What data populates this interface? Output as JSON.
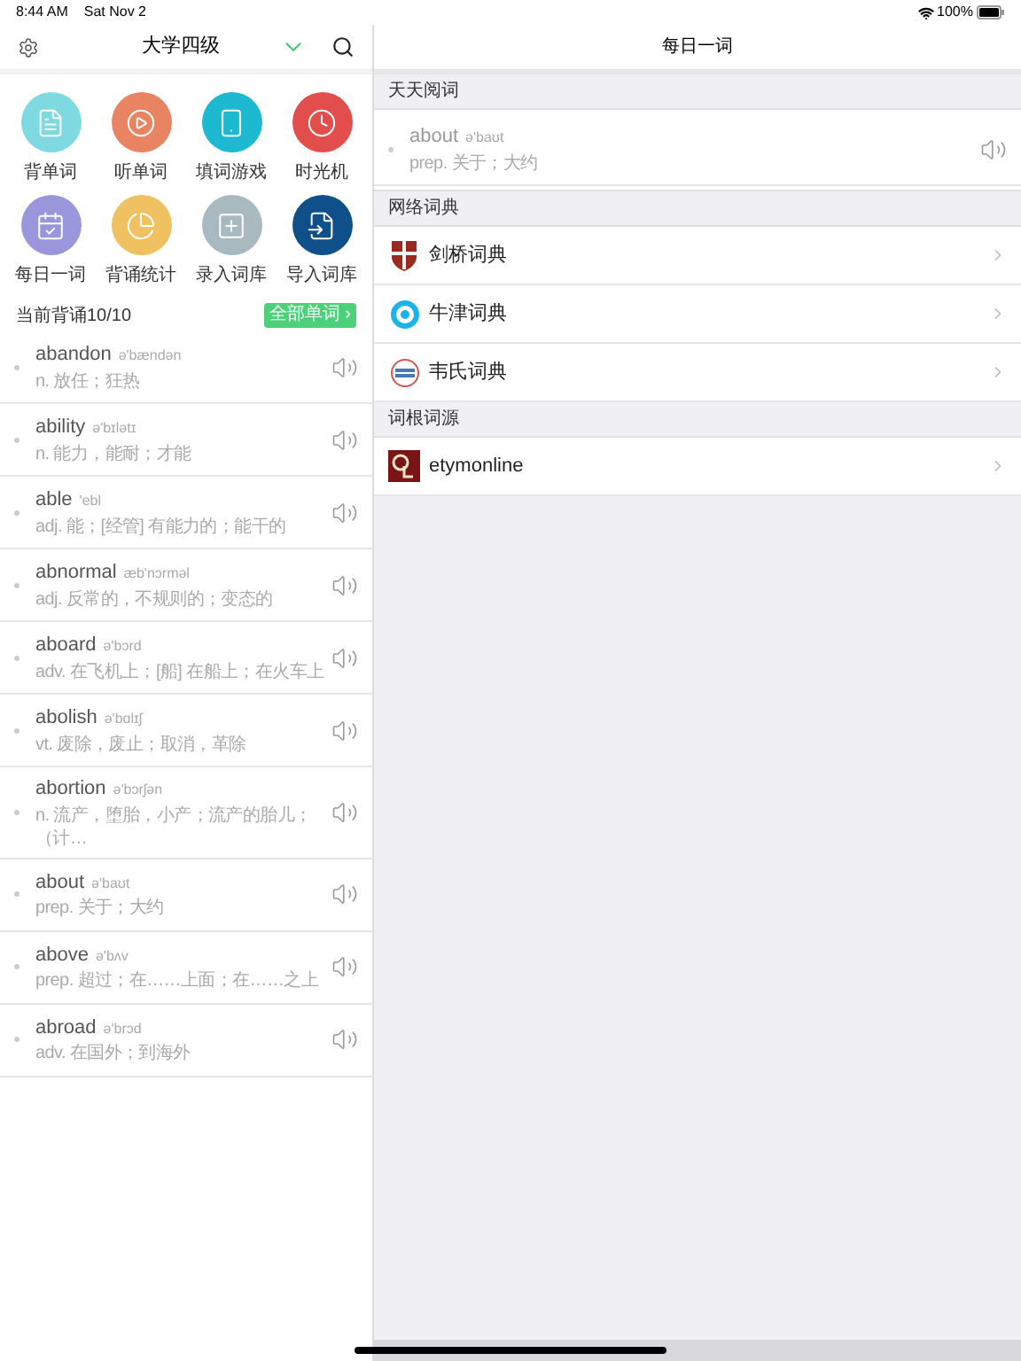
{
  "status_bar": {
    "time": "8:44 AM",
    "date": "Sat Nov 2",
    "battery": "100%"
  },
  "left_header": {
    "title": "大学四级"
  },
  "features": [
    {
      "label": "背单词",
      "color": "#7fd9e0"
    },
    {
      "label": "听单词",
      "color": "#e98462"
    },
    {
      "label": "填词游戏",
      "color": "#1cb9d1"
    },
    {
      "label": "时光机",
      "color": "#e24e4b"
    },
    {
      "label": "每日一词",
      "color": "#9a96db"
    },
    {
      "label": "背诵统计",
      "color": "#f0c160"
    },
    {
      "label": "录入词库",
      "color": "#a9b9c0"
    },
    {
      "label": "导入词库",
      "color": "#0f4f8a"
    }
  ],
  "progress": {
    "label": "当前背诵10/10",
    "all_words_button": "全部单词 ›"
  },
  "words": [
    {
      "word": "abandon",
      "phonetic": "ə'bændən",
      "meaning": "n. 放任；狂热"
    },
    {
      "word": "ability",
      "phonetic": "ə'bɪlətɪ",
      "meaning": "n. 能力，能耐；才能"
    },
    {
      "word": "able",
      "phonetic": "'ebl",
      "meaning": "adj. 能；[经管] 有能力的；能干的"
    },
    {
      "word": "abnormal",
      "phonetic": "æb'nɔrməl",
      "meaning": "adj. 反常的，不规则的；变态的"
    },
    {
      "word": "aboard",
      "phonetic": "ə'bɔrd",
      "meaning": "adv. 在飞机上；[船] 在船上；在火车上"
    },
    {
      "word": "abolish",
      "phonetic": "ə'bɑlɪʃ",
      "meaning": "vt. 废除，废止；取消，革除"
    },
    {
      "word": "abortion",
      "phonetic": "ə'bɔrʃən",
      "meaning": "n. 流产，堕胎，小产；流产的胎儿；（计…"
    },
    {
      "word": "about",
      "phonetic": "ə'baʊt",
      "meaning": "prep. 关于；大约"
    },
    {
      "word": "above",
      "phonetic": "ə'bʌv",
      "meaning": "prep. 超过；在……上面；在……之上"
    },
    {
      "word": "abroad",
      "phonetic": "ə'brɔd",
      "meaning": "adv. 在国外；到海外"
    }
  ],
  "right_header": {
    "title": "每日一词"
  },
  "sections": [
    {
      "title": "天天阅词",
      "items": [
        {
          "kind": "word",
          "word": "about",
          "phonetic": "ə'baʊt",
          "meaning": "prep. 关于；大约"
        }
      ]
    },
    {
      "title": "网络词典",
      "items": [
        {
          "kind": "link",
          "label": "剑桥词典"
        },
        {
          "kind": "link",
          "label": "牛津词典"
        },
        {
          "kind": "link",
          "label": "韦氏词典"
        }
      ]
    },
    {
      "title": "词根词源",
      "items": [
        {
          "kind": "link",
          "label": "etymonline"
        }
      ]
    }
  ]
}
